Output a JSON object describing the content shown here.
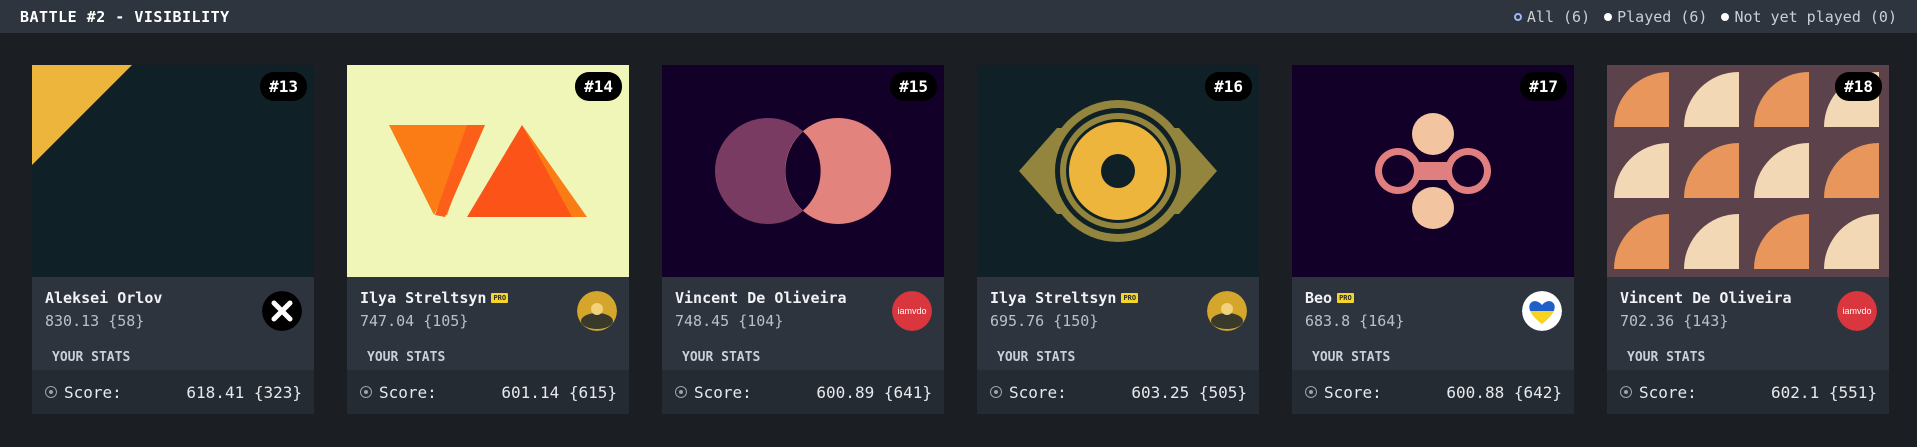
{
  "header": {
    "title": "BATTLE #2 - VISIBILITY",
    "filters": [
      {
        "label": "All (6)",
        "active": true
      },
      {
        "label": "Played (6)",
        "active": false
      },
      {
        "label": "Not yet played (0)",
        "active": false
      }
    ]
  },
  "cards": [
    {
      "rank": "#13",
      "author": "Aleksei Orlov",
      "pro": false,
      "score": "830.13 {58}",
      "stats_label": "YOUR STATS",
      "your_score_label": "Score:",
      "your_score": "618.41 {323}"
    },
    {
      "rank": "#14",
      "author": "Ilya Streltsyn",
      "pro": true,
      "pro_label": "PRO",
      "score": "747.04 {105}",
      "stats_label": "YOUR STATS",
      "your_score_label": "Score:",
      "your_score": "601.14 {615}"
    },
    {
      "rank": "#15",
      "author": "Vincent De Oliveira",
      "pro": false,
      "score": "748.45 {104}",
      "avatar_text": "iamvdo",
      "stats_label": "YOUR STATS",
      "your_score_label": "Score:",
      "your_score": "600.89 {641}"
    },
    {
      "rank": "#16",
      "author": "Ilya Streltsyn",
      "pro": true,
      "pro_label": "PRO",
      "score": "695.76 {150}",
      "stats_label": "YOUR STATS",
      "your_score_label": "Score:",
      "your_score": "603.25 {505}"
    },
    {
      "rank": "#17",
      "author": "Beo",
      "pro": true,
      "pro_label": "PRO",
      "score": "683.8 {164}",
      "stats_label": "YOUR STATS",
      "your_score_label": "Score:",
      "your_score": "600.88 {642}"
    },
    {
      "rank": "#18",
      "author": "Vincent De Oliveira",
      "pro": false,
      "score": "702.36 {143}",
      "avatar_text": "iamvdo",
      "stats_label": "YOUR STATS",
      "your_score_label": "Score:",
      "your_score": "602.1 {551}"
    }
  ],
  "icons": {
    "filter_active": "radio-selected-icon",
    "filter_inactive": "radio-dot-icon",
    "score": "target-icon"
  },
  "colors": {
    "topbar": "#2e353f",
    "background": "#1b1f24",
    "card": "#2d343e",
    "score_row": "#252b33",
    "pro_badge": "#f4d52c",
    "iamvdo_avatar": "#d9363e"
  }
}
